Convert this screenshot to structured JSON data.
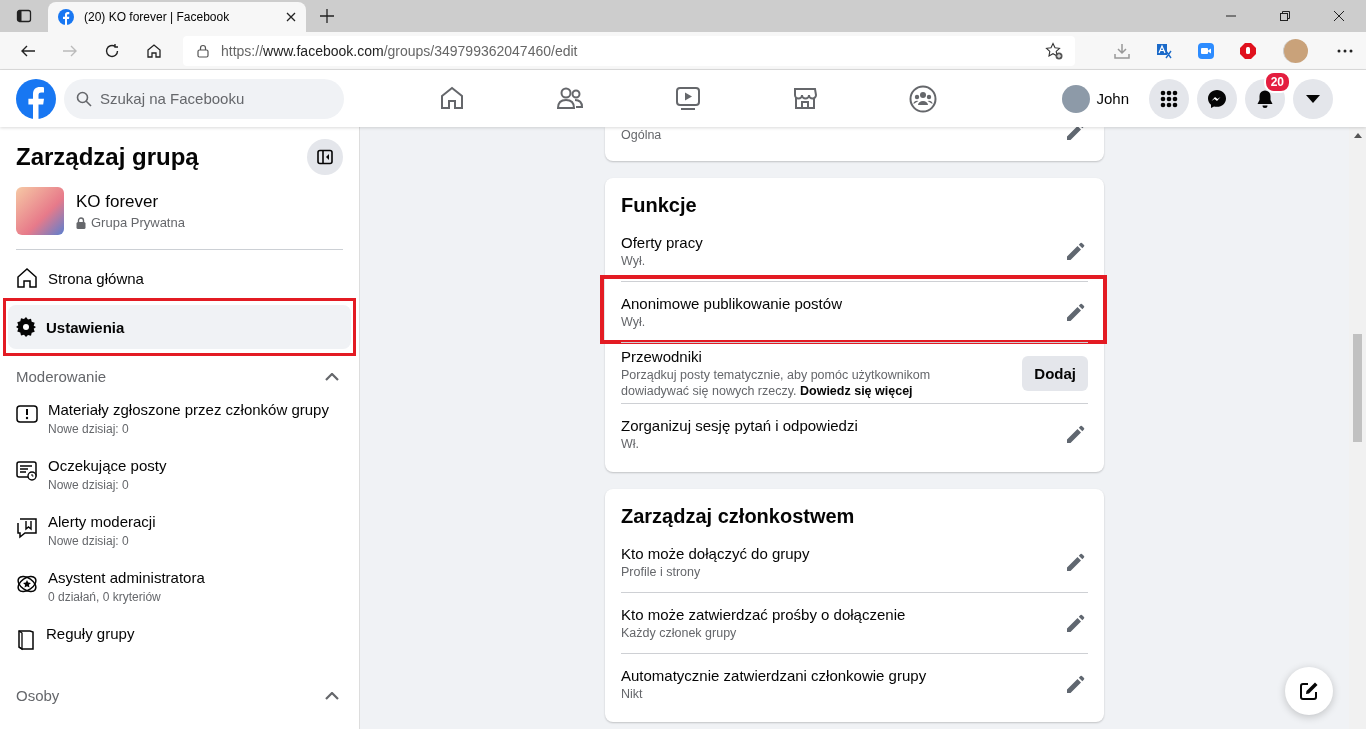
{
  "browser": {
    "tab": {
      "title": "(20) KO forever | Facebook"
    },
    "url": {
      "scheme": "https://",
      "host": "www.facebook.com",
      "path": "/groups/349799362047460/edit"
    }
  },
  "header": {
    "search": {
      "placeholder": "Szukaj na Facebooku"
    },
    "profile_name": "John",
    "notification_count": "20"
  },
  "sidebar": {
    "title": "Zarządzaj grupą",
    "group": {
      "name": "KO forever",
      "privacy": "Grupa Prywatna"
    },
    "items": [
      {
        "kind": "home",
        "label": "Strona główna",
        "selected": false,
        "highlighted": false
      },
      {
        "kind": "settings",
        "label": "Ustawienia",
        "selected": true,
        "highlighted": true
      }
    ],
    "sections": [
      {
        "title": "Moderowanie",
        "expanded": true,
        "items": [
          {
            "kind": "report",
            "label": "Materiały zgłoszone przez członków grupy",
            "sub": "Nowe dzisiaj: 0"
          },
          {
            "kind": "pending",
            "label": "Oczekujące posty",
            "sub": "Nowe dzisiaj: 0"
          },
          {
            "kind": "alert",
            "label": "Alerty moderacji",
            "sub": "Nowe dzisiaj: 0"
          },
          {
            "kind": "assistant",
            "label": "Asystent administratora",
            "sub": "0 działań, 0 kryteriów"
          },
          {
            "kind": "rules",
            "label": "Reguły grupy"
          }
        ]
      },
      {
        "title": "Osoby",
        "expanded": true
      }
    ]
  },
  "cards": [
    {
      "rows": [
        {
          "kind": "edit",
          "sub": "Ogólna",
          "highlighted": false
        }
      ]
    },
    {
      "title": "Funkcje",
      "rows": [
        {
          "kind": "edit",
          "title": "Oferty pracy",
          "sub": "Wył.",
          "highlighted": false
        },
        {
          "kind": "edit",
          "title": "Anonimowe publikowanie postów",
          "sub": "Wył.",
          "highlighted": true
        },
        {
          "kind": "button",
          "title": "Przewodniki",
          "sub": "Porządkuj posty tematycznie, aby pomóc użytkownikom dowiadywać się nowych rzeczy.",
          "link": "Dowiedz się więcej",
          "button": "Dodaj",
          "highlighted": false
        },
        {
          "kind": "edit",
          "title": "Zorganizuj sesję pytań i odpowiedzi",
          "sub": "Wł.",
          "highlighted": false
        }
      ]
    },
    {
      "title": "Zarządzaj członkostwem",
      "rows": [
        {
          "kind": "edit",
          "title": "Kto może dołączyć do grupy",
          "sub": "Profile i strony",
          "highlighted": false
        },
        {
          "kind": "edit",
          "title": "Kto może zatwierdzać prośby o dołączenie",
          "sub": "Każdy członek grupy",
          "highlighted": false
        },
        {
          "kind": "edit",
          "title": "Automatycznie zatwierdzani członkowie grupy",
          "sub": "Nikt",
          "highlighted": false
        }
      ]
    }
  ]
}
